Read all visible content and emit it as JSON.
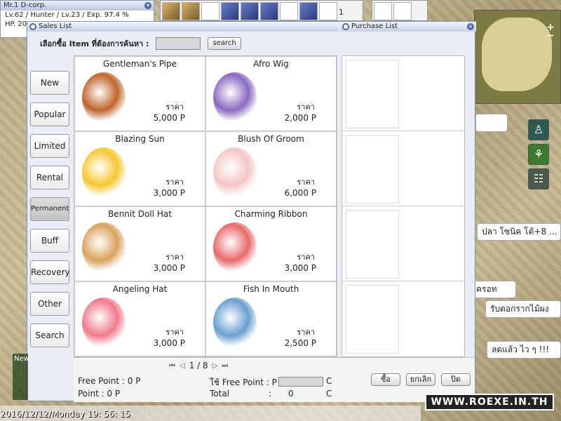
{
  "char": {
    "title": "Mr.1 D-corp.",
    "line1": "Lv.62 / Hunter / Lv.23 / Exp. 97.4 %",
    "line2": "HP. 20"
  },
  "hotbar": {
    "count": "1"
  },
  "sales": {
    "title": "Sales List",
    "search_label": "เลือกซื้อ Item ที่ต้องการค้นหา :",
    "search_button": "search"
  },
  "purchase": {
    "title": "Purchase List"
  },
  "categories": [
    {
      "label": "New"
    },
    {
      "label": "Popular"
    },
    {
      "label": "Limited"
    },
    {
      "label": "Rental"
    },
    {
      "label": "Permanent"
    },
    {
      "label": "Buff"
    },
    {
      "label": "Recovery"
    },
    {
      "label": "Other"
    },
    {
      "label": "Search"
    }
  ],
  "items": [
    {
      "name": "Gentleman's Pipe",
      "price_label": "ราคา",
      "price": "5,000 P",
      "color": "#c0642a"
    },
    {
      "name": "Afro Wig",
      "price_label": "ราคา",
      "price": "2,000 P",
      "color": "#8a6ac0"
    },
    {
      "name": "Blazing Sun",
      "price_label": "ราคา",
      "price": "3,000 P",
      "color": "#f5c832"
    },
    {
      "name": "Blush Of Groom",
      "price_label": "ราคา",
      "price": "6,000 P",
      "color": "#f4c6c6"
    },
    {
      "name": "Bennit Doll Hat",
      "price_label": "ราคา",
      "price": "3,000 P",
      "color": "#d9a35e"
    },
    {
      "name": "Charming Ribbon",
      "price_label": "ราคา",
      "price": "3,000 P",
      "color": "#e86a6a"
    },
    {
      "name": "Angeling Hat",
      "price_label": "ราคา",
      "price": "3,000 P",
      "color": "#f07a8a"
    },
    {
      "name": "Fish In Mouth",
      "price_label": "ราคา",
      "price": "2,500 P",
      "color": "#6aa0d0"
    }
  ],
  "pager": {
    "text": "1 / 8"
  },
  "footer": {
    "free_point": "Free Point : 0 P",
    "point": "Point : 0 P",
    "use_free": "ใช้ Free Point : P",
    "c1": "C",
    "total_label": "Total",
    "colon": ":",
    "total": "0",
    "c2": "C",
    "buy": "ซื้อ",
    "cancel": "ยกเลิก",
    "close": "ปิด"
  },
  "side": {
    "box1": "ปลา โซนิค โต้+8 ...",
    "box2": "ครอท",
    "box3": "รับดอกรากไม้ผง",
    "box4": "ลดแล้ว ไว ๆ !!!"
  },
  "chat": {
    "label": "New"
  },
  "datetime": "2016/12/12/Monday  19: 56: 15",
  "watermark": "WWW.ROEXE.IN.TH"
}
